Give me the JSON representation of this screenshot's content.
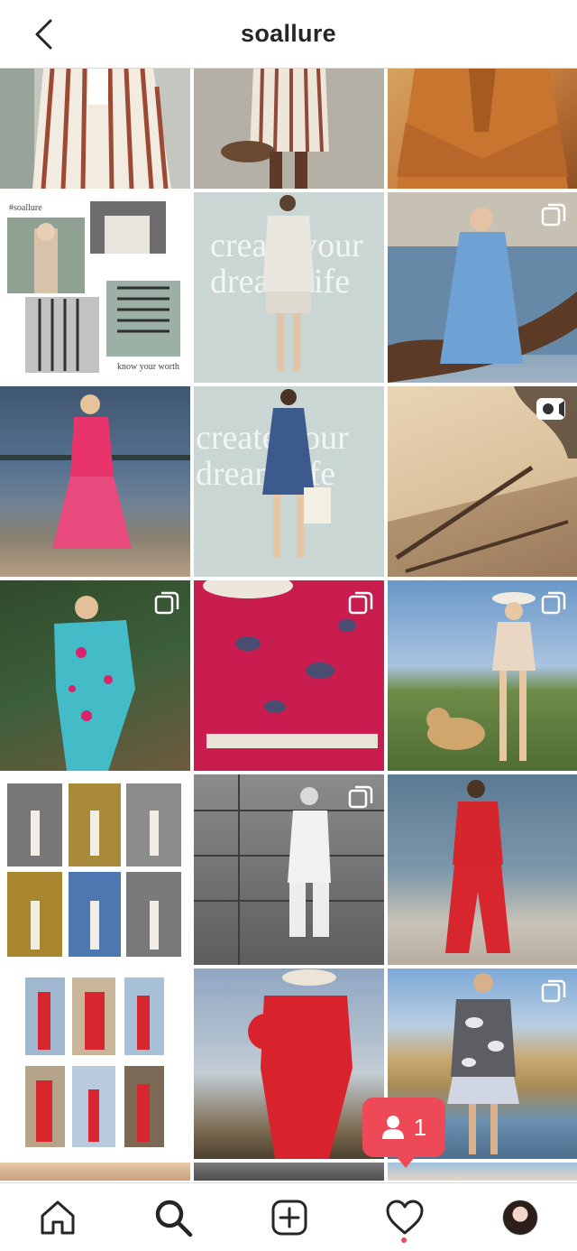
{
  "header": {
    "title": "soallure",
    "back_icon": "chevron-left-icon"
  },
  "grid": {
    "tiles": [
      {
        "name": "post-striped-blazer",
        "badge": null
      },
      {
        "name": "post-striped-shorts-hat",
        "badge": null
      },
      {
        "name": "post-camel-coat",
        "badge": null
      },
      {
        "name": "post-collage-striped-set",
        "badge": null,
        "caption_top": "#soallure",
        "caption_bottom": "know your worth"
      },
      {
        "name": "post-create-your-dream-life-white",
        "badge": null,
        "overlay": "create your dream life"
      },
      {
        "name": "post-denim-dress-tree",
        "badge": "carousel"
      },
      {
        "name": "post-pink-dress-beach",
        "badge": null
      },
      {
        "name": "post-create-your-dream-life-denim",
        "badge": null,
        "overlay": "create your dream life"
      },
      {
        "name": "post-shadow-wall-video",
        "badge": "video"
      },
      {
        "name": "post-floral-wrap-dress",
        "badge": "carousel"
      },
      {
        "name": "post-pink-print-blouse",
        "badge": "carousel"
      },
      {
        "name": "post-peplum-dog-field",
        "badge": "carousel"
      },
      {
        "name": "post-collage-neutral-looks",
        "badge": null
      },
      {
        "name": "post-white-jumpsuit-wall",
        "badge": "carousel"
      },
      {
        "name": "post-red-set-lake",
        "badge": null
      },
      {
        "name": "post-collage-red-looks",
        "badge": null
      },
      {
        "name": "post-red-jumpsuit-sky",
        "badge": null
      },
      {
        "name": "post-tie-dye-sweater",
        "badge": "carousel"
      },
      {
        "name": "post-partial-1",
        "badge": null
      },
      {
        "name": "post-partial-2",
        "badge": "carousel"
      },
      {
        "name": "post-partial-3",
        "badge": "carousel"
      }
    ]
  },
  "notification": {
    "icon": "user-icon",
    "count": "1"
  },
  "tabbar": {
    "items": [
      {
        "name": "home",
        "icon": "home-icon"
      },
      {
        "name": "search",
        "icon": "search-icon"
      },
      {
        "name": "new-post",
        "icon": "plus-square-icon"
      },
      {
        "name": "activity",
        "icon": "heart-icon"
      },
      {
        "name": "profile",
        "icon": "avatar"
      }
    ]
  },
  "colors": {
    "accent_notification": "#ed4956",
    "text": "#262626",
    "divider": "#dbdbdb"
  }
}
